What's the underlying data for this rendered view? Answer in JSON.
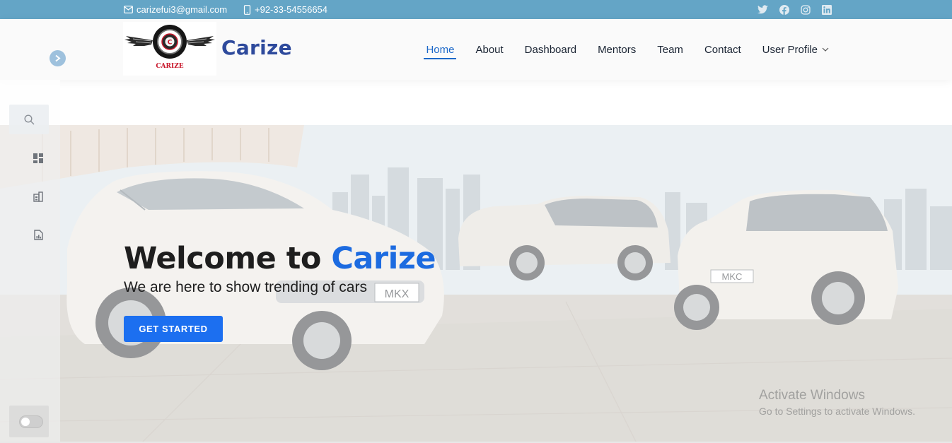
{
  "topbar": {
    "email": "carizefui3@gmail.com",
    "phone": "+92-33-54556654",
    "social_icons": [
      "twitter-icon",
      "facebook-icon",
      "instagram-icon",
      "linkedin-icon"
    ],
    "background_color": "#64a5c6"
  },
  "header": {
    "logo_text": "CARIZE",
    "brand": "Carize",
    "nav": [
      {
        "label": "Home",
        "active": true
      },
      {
        "label": "About"
      },
      {
        "label": "Dashboard"
      },
      {
        "label": "Mentors"
      },
      {
        "label": "Team"
      },
      {
        "label": "Contact"
      },
      {
        "label": "User Profile",
        "dropdown": true
      }
    ],
    "accent_color": "#1c68c9",
    "brand_color": "#2e4a9c"
  },
  "sidebar": {
    "icons": [
      "search-icon",
      "dashboard-icon",
      "building-icon",
      "report-icon"
    ],
    "toggle_icon": "toggle-switch",
    "expand_icon": "chevron-right-icon"
  },
  "hero": {
    "title_prefix": "Welcome to",
    "title_accent": "Carize",
    "subtitle": "We are here to show trending of cars",
    "cta_label": "GET STARTED",
    "cta_color": "#1c6ff0",
    "car_badges": [
      "MKX",
      "MKC"
    ]
  },
  "watermark": {
    "line1": "Activate Windows",
    "line2": "Go to Settings to activate Windows."
  }
}
